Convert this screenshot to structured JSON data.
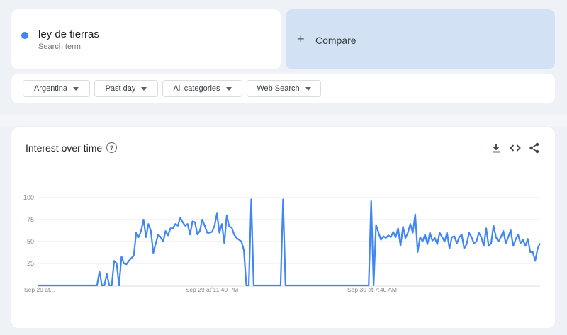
{
  "search_term": {
    "name": "ley de tierras",
    "sublabel": "Search term",
    "color": "#4285f4"
  },
  "compare": {
    "label": "Compare"
  },
  "filters": [
    {
      "label": "Argentina"
    },
    {
      "label": "Past day"
    },
    {
      "label": "All categories"
    },
    {
      "label": "Web Search"
    }
  ],
  "chart": {
    "title": "Interest over time",
    "tools": [
      "download-icon",
      "embed-icon",
      "share-icon"
    ]
  },
  "chart_data": {
    "type": "line",
    "ylim": [
      0,
      100
    ],
    "yticks": [
      100,
      75,
      50,
      25
    ],
    "xtick_labels": [
      "Sep 29 at...",
      "Sep 29 at 11:40 PM",
      "Sep 30 at 7:40 AM"
    ],
    "series": [
      {
        "color": "#4285f4",
        "values": [
          0,
          0,
          0,
          0,
          0,
          0,
          0,
          0,
          0,
          0,
          0,
          0,
          0,
          0,
          0,
          0,
          0,
          0,
          0,
          0,
          0,
          0,
          0,
          0,
          0,
          16,
          0,
          0,
          13,
          0,
          0,
          28,
          25,
          0,
          33,
          25,
          24,
          28,
          31,
          34,
          60,
          55,
          62,
          75,
          55,
          70,
          62,
          37,
          48,
          58,
          55,
          50,
          62,
          57,
          65,
          65,
          70,
          68,
          77,
          72,
          68,
          70,
          58,
          73,
          72,
          58,
          62,
          75,
          68,
          60,
          60,
          61,
          68,
          82,
          60,
          70,
          48,
          80,
          67,
          66,
          58,
          54,
          52,
          50,
          40,
          0,
          0,
          98,
          0,
          0,
          0,
          0,
          0,
          0,
          0,
          0,
          0,
          0,
          0,
          0,
          98,
          0,
          0,
          0,
          0,
          0,
          0,
          0,
          0,
          0,
          0,
          0,
          0,
          0,
          0,
          0,
          0,
          0,
          0,
          0,
          0,
          0,
          0,
          0,
          0,
          0,
          0,
          0,
          0,
          0,
          0,
          0,
          0,
          0,
          0,
          0,
          96,
          0,
          69,
          60,
          52,
          56,
          54,
          57,
          55,
          61,
          55,
          65,
          45,
          67,
          54,
          60,
          70,
          60,
          81,
          38,
          55,
          50,
          58,
          47,
          60,
          51,
          54,
          47,
          60,
          55,
          50,
          60,
          42,
          55,
          56,
          48,
          55,
          58,
          42,
          47,
          60,
          55,
          48,
          50,
          60,
          55,
          45,
          65,
          45,
          48,
          68,
          55,
          50,
          55,
          62,
          48,
          55,
          63,
          45,
          52,
          58,
          48,
          52,
          45,
          53,
          38,
          38,
          28,
          42,
          48
        ]
      }
    ]
  }
}
